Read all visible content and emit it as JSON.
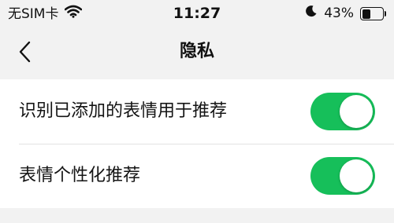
{
  "status_bar": {
    "carrier": "无SIM卡",
    "time": "11:27",
    "battery_percent": "43%",
    "battery_level": 0.43,
    "wifi_icon": "wifi-icon",
    "dnd_icon": "moon-icon"
  },
  "nav": {
    "back_icon": "chevron-left-icon",
    "title": "隐私"
  },
  "settings": [
    {
      "label": "识别已添加的表情用于推荐",
      "enabled": true
    },
    {
      "label": "表情个性化推荐",
      "enabled": true
    }
  ],
  "colors": {
    "toggle_on": "#16bf5a",
    "background": "#f2f2f2"
  }
}
